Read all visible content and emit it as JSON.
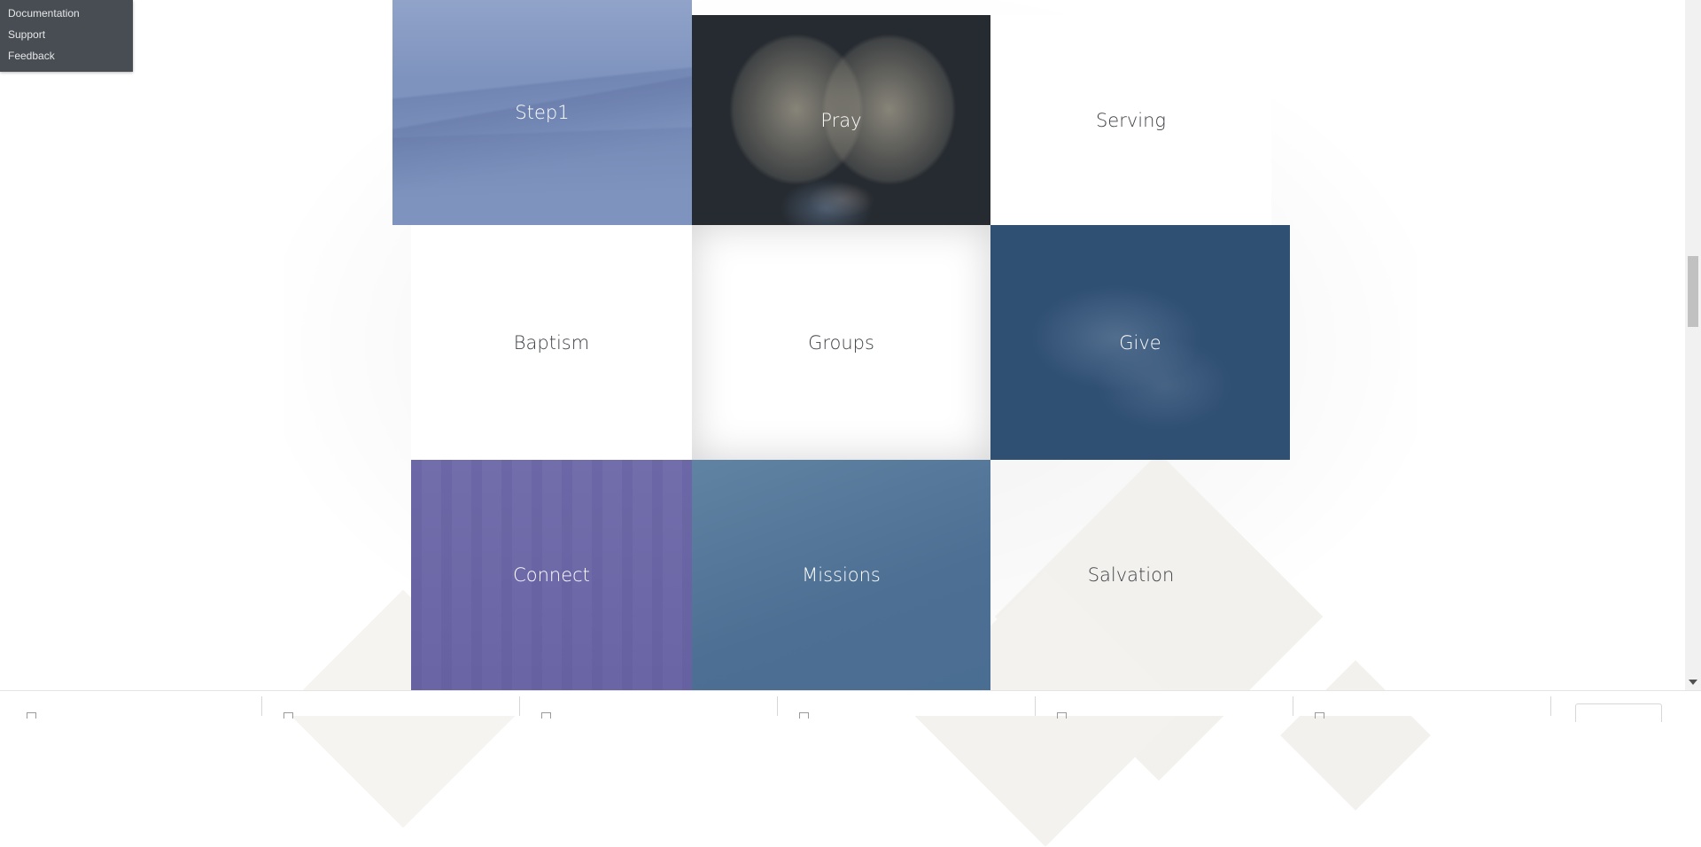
{
  "dev_menu": {
    "items": [
      {
        "label": "Documentation"
      },
      {
        "label": "Support"
      },
      {
        "label": "Feedback"
      }
    ]
  },
  "tiles": [
    {
      "id": "step1",
      "label": "Step1",
      "style": "dark",
      "bg_color": "#7e93be"
    },
    {
      "id": "pray",
      "label": "Pray",
      "style": "dark",
      "bg_color": "#262b31"
    },
    {
      "id": "serving",
      "label": "Serving",
      "style": "light",
      "bg_color": "#ffffff"
    },
    {
      "id": "baptism",
      "label": "Baptism",
      "style": "light",
      "bg_color": "#ffffff"
    },
    {
      "id": "groups",
      "label": "Groups",
      "style": "light",
      "bg_color": "#ffffff"
    },
    {
      "id": "give",
      "label": "Give",
      "style": "dark",
      "bg_color": "#2f4f73"
    },
    {
      "id": "connect",
      "label": "Connect",
      "style": "dark",
      "bg_color": "#6e6aa8"
    },
    {
      "id": "missions",
      "label": "Missions",
      "style": "dark",
      "bg_color": "#55789b"
    },
    {
      "id": "salvation",
      "label": "Salvation",
      "style": "light",
      "bg_color": "transparent"
    }
  ],
  "icons": {
    "scroll_down": "chevron-down-icon",
    "bottom_item": "document-icon"
  },
  "colors": {
    "menu_bg": "#474d52",
    "menu_text": "#e6e8ea",
    "light_label": "#3f4146",
    "dark_label": "#ffffff"
  }
}
